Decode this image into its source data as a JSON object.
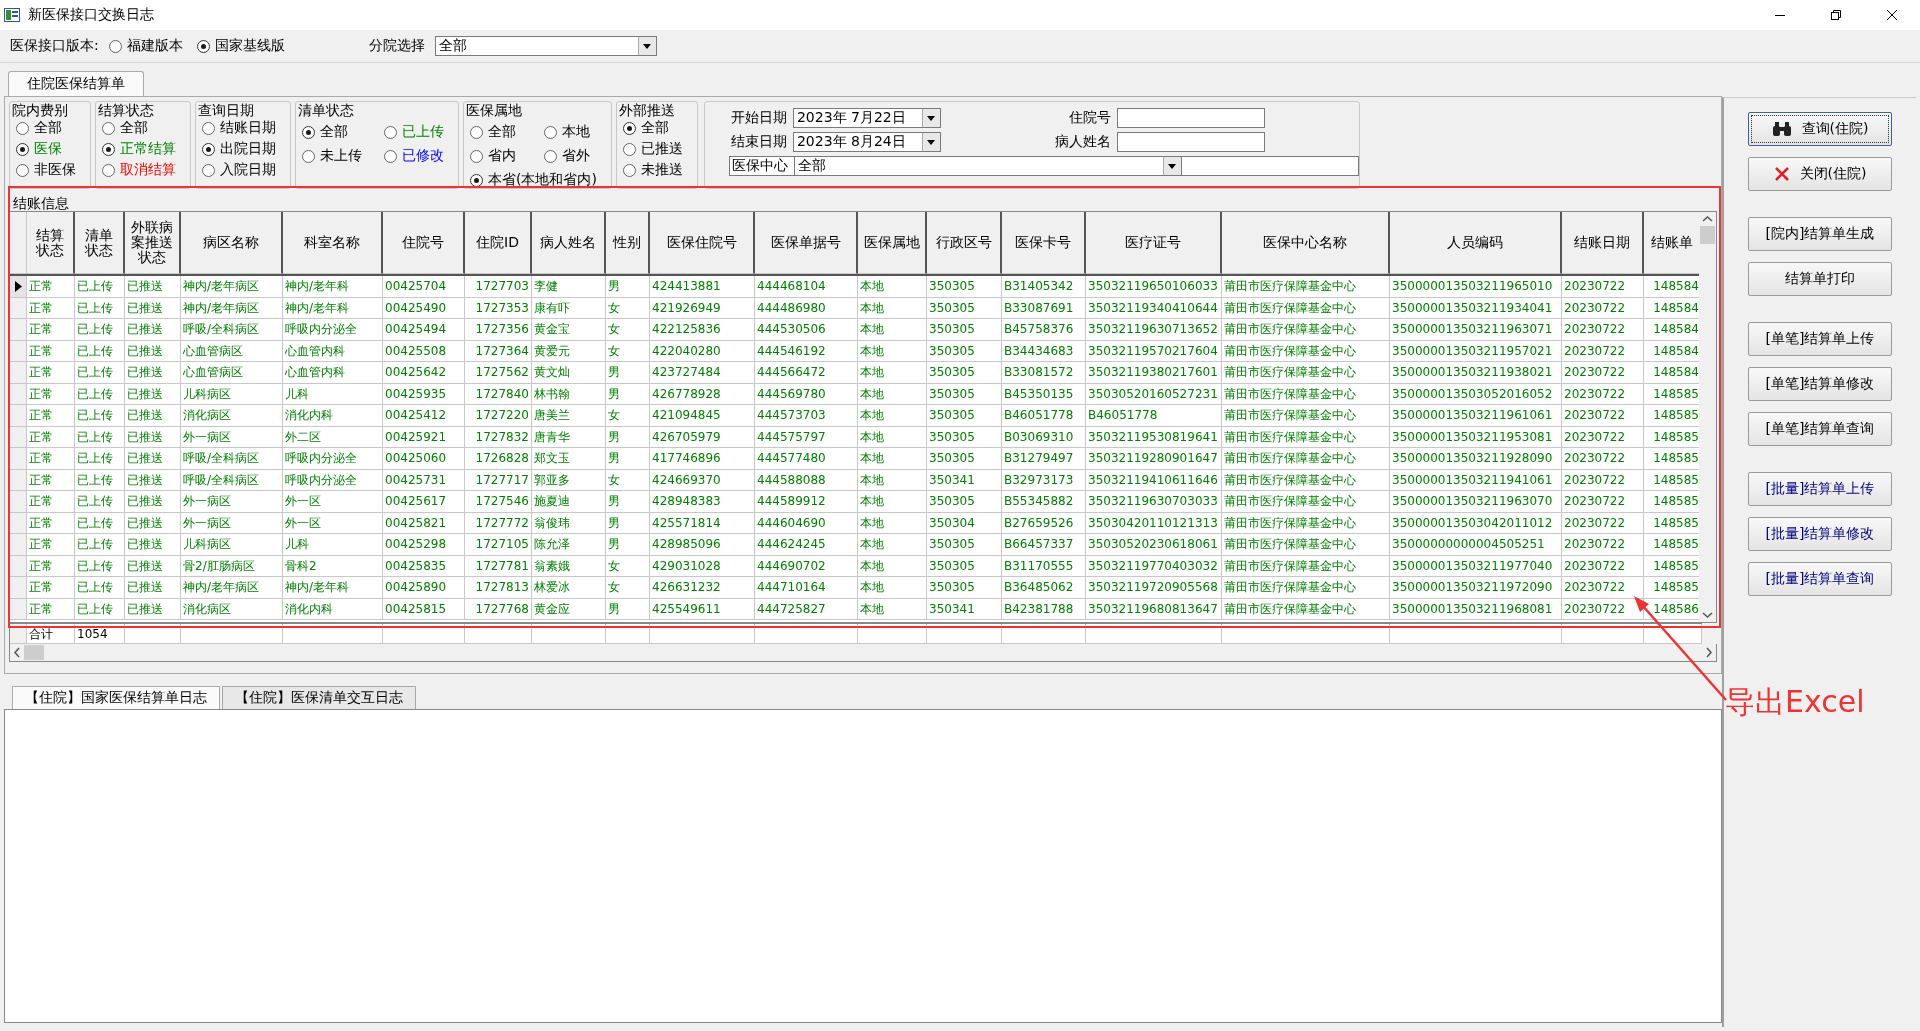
{
  "window": {
    "title": "新医保接口交换日志"
  },
  "version_bar": {
    "label": "医保接口版本:",
    "options": [
      {
        "label": "福建版本",
        "selected": false
      },
      {
        "label": "国家基线版",
        "selected": true
      }
    ],
    "branch_label": "分院选择",
    "branch_value": "全部"
  },
  "main_tab": {
    "label": "住院医保结算单",
    "selected": true
  },
  "filter_groups": [
    {
      "title": "院内费别",
      "kind": "stack",
      "options": [
        {
          "label": "全部",
          "selected": false
        },
        {
          "label": "医保",
          "selected": true,
          "color": "#008000"
        },
        {
          "label": "非医保",
          "selected": false
        }
      ]
    },
    {
      "title": "结算状态",
      "kind": "stack",
      "options": [
        {
          "label": "全部",
          "selected": false
        },
        {
          "label": "正常结算",
          "selected": true,
          "color": "#008000"
        },
        {
          "label": "取消结算",
          "selected": false,
          "color": "#ff0000"
        }
      ]
    },
    {
      "title": "查询日期",
      "kind": "stack",
      "options": [
        {
          "label": "结账日期",
          "selected": false
        },
        {
          "label": "出院日期",
          "selected": true
        },
        {
          "label": "入院日期",
          "selected": false
        }
      ]
    },
    {
      "title": "清单状态",
      "kind": "grid",
      "options": [
        {
          "label": "全部",
          "selected": true
        },
        {
          "label": "已上传",
          "selected": false,
          "color": "#008000"
        },
        {
          "label": "未上传",
          "selected": false
        },
        {
          "label": "已修改",
          "selected": false,
          "color": "#0000ff"
        }
      ]
    },
    {
      "title": "医保属地",
      "kind": "grid",
      "options": [
        {
          "label": "全部",
          "selected": false
        },
        {
          "label": "本地",
          "selected": false
        },
        {
          "label": "省内",
          "selected": false
        },
        {
          "label": "省外",
          "selected": false
        },
        {
          "label": "本省(本地和省内)",
          "selected": true
        }
      ]
    },
    {
      "title": "外部推送",
      "kind": "stack",
      "options": [
        {
          "label": "全部",
          "selected": true
        },
        {
          "label": "已推送",
          "selected": false
        },
        {
          "label": "未推送",
          "selected": false
        }
      ]
    }
  ],
  "search_fields": [
    {
      "label": "开始日期",
      "kind": "date",
      "value": "2023年 7月22日"
    },
    {
      "label": "住院号",
      "kind": "text"
    },
    {
      "label": "结束日期",
      "kind": "date",
      "value": "2023年 8月24日"
    },
    {
      "label": "病人姓名",
      "kind": "text"
    },
    {
      "label": "医保中心",
      "kind": "combo",
      "value": "全部"
    }
  ],
  "table": {
    "title": "结账信息",
    "columns": [
      "结算状态",
      "清单状态",
      "外联病案推送状态",
      "病区名称",
      "科室名称",
      "住院号",
      "住院ID",
      "病人姓名",
      "性别",
      "医保住院号",
      "医保单据号",
      "医保属地",
      "行政区号",
      "医保卡号",
      "医疗证号",
      "医保中心名称",
      "人员编码",
      "结账日期",
      "结账单"
    ],
    "rows": [
      {
        "selected": true,
        "cells": [
          "正常",
          "已上传",
          "已推送",
          "神内/老年病区",
          "神内/老年科",
          "00425704",
          "1727703",
          "李健",
          "男",
          "424413881",
          "444468104",
          "本地",
          "350305",
          "B31405342",
          "35032119650106033",
          "莆田市医疗保障基金中心",
          "350000013503211965010",
          "20230722",
          "148584"
        ]
      },
      {
        "selected": false,
        "cells": [
          "正常",
          "已上传",
          "已推送",
          "神内/老年病区",
          "神内/老年科",
          "00425490",
          "1727353",
          "康有吓",
          "女",
          "421926949",
          "444486980",
          "本地",
          "350305",
          "B33087691",
          "35032119340410644",
          "莆田市医疗保障基金中心",
          "350000013503211934041",
          "20230722",
          "148584"
        ]
      },
      {
        "selected": false,
        "cells": [
          "正常",
          "已上传",
          "已推送",
          "呼吸/全科病区",
          "呼吸内分泌全",
          "00425494",
          "1727356",
          "黄金宝",
          "女",
          "422125836",
          "444530506",
          "本地",
          "350305",
          "B45758376",
          "35032119630713652",
          "莆田市医疗保障基金中心",
          "350000013503211963071",
          "20230722",
          "148584"
        ]
      },
      {
        "selected": false,
        "cells": [
          "正常",
          "已上传",
          "已推送",
          "心血管病区",
          "心血管内科",
          "00425508",
          "1727364",
          "黄爱元",
          "女",
          "422040280",
          "444546192",
          "本地",
          "350305",
          "B34434683",
          "35032119570217604",
          "莆田市医疗保障基金中心",
          "350000013503211957021",
          "20230722",
          "148584"
        ]
      },
      {
        "selected": false,
        "cells": [
          "正常",
          "已上传",
          "已推送",
          "心血管病区",
          "心血管内科",
          "00425642",
          "1727562",
          "黄文灿",
          "男",
          "423727484",
          "444566472",
          "本地",
          "350305",
          "B33081572",
          "35032119380217601",
          "莆田市医疗保障基金中心",
          "350000013503211938021",
          "20230722",
          "148584"
        ]
      },
      {
        "selected": false,
        "cells": [
          "正常",
          "已上传",
          "已推送",
          "儿科病区",
          "儿科",
          "00425935",
          "1727840",
          "林书翰",
          "男",
          "426778928",
          "444569780",
          "本地",
          "350305",
          "B45350135",
          "35030520160527231",
          "莆田市医疗保障基金中心",
          "350000013503052016052",
          "20230722",
          "148585"
        ]
      },
      {
        "selected": false,
        "cells": [
          "正常",
          "已上传",
          "已推送",
          "消化病区",
          "消化内科",
          "00425412",
          "1727220",
          "唐美兰",
          "女",
          "421094845",
          "444573703",
          "本地",
          "350305",
          "B46051778",
          "B46051778",
          "莆田市医疗保障基金中心",
          "350000013503211961061",
          "20230722",
          "148585"
        ]
      },
      {
        "selected": false,
        "cells": [
          "正常",
          "已上传",
          "已推送",
          "外一病区",
          "外二区",
          "00425921",
          "1727832",
          "唐青华",
          "男",
          "426705979",
          "444575797",
          "本地",
          "350305",
          "B03069310",
          "35032119530819641",
          "莆田市医疗保障基金中心",
          "350000013503211953081",
          "20230722",
          "148585"
        ]
      },
      {
        "selected": false,
        "cells": [
          "正常",
          "已上传",
          "已推送",
          "呼吸/全科病区",
          "呼吸内分泌全",
          "00425060",
          "1726828",
          "郑文玉",
          "男",
          "417746896",
          "444577480",
          "本地",
          "350305",
          "B31279497",
          "35032119280901647",
          "莆田市医疗保障基金中心",
          "350000013503211928090",
          "20230722",
          "148585"
        ]
      },
      {
        "selected": false,
        "cells": [
          "正常",
          "已上传",
          "已推送",
          "呼吸/全科病区",
          "呼吸内分泌全",
          "00425731",
          "1727717",
          "郭亚多",
          "女",
          "424669370",
          "444588088",
          "本地",
          "350341",
          "B32973173",
          "35032119410611646",
          "莆田市医疗保障基金中心",
          "350000013503211941061",
          "20230722",
          "148585"
        ]
      },
      {
        "selected": false,
        "cells": [
          "正常",
          "已上传",
          "已推送",
          "外一病区",
          "外一区",
          "00425617",
          "1727546",
          "施夏迪",
          "男",
          "428948383",
          "444589912",
          "本地",
          "350305",
          "B55345882",
          "35032119630703033",
          "莆田市医疗保障基金中心",
          "350000013503211963070",
          "20230722",
          "148585"
        ]
      },
      {
        "selected": false,
        "cells": [
          "正常",
          "已上传",
          "已推送",
          "外一病区",
          "外一区",
          "00425821",
          "1727772",
          "翁俊玮",
          "男",
          "425571814",
          "444604690",
          "本地",
          "350304",
          "B27659526",
          "35030420110121313",
          "莆田市医疗保障基金中心",
          "350000013503042011012",
          "20230722",
          "148585"
        ]
      },
      {
        "selected": false,
        "cells": [
          "正常",
          "已上传",
          "已推送",
          "儿科病区",
          "儿科",
          "00425298",
          "1727105",
          "陈允泽",
          "男",
          "428985096",
          "444624245",
          "本地",
          "350305",
          "B66457337",
          "35030520230618061",
          "莆田市医疗保障基金中心",
          "35000000000004505251",
          "20230722",
          "148585"
        ]
      },
      {
        "selected": false,
        "cells": [
          "正常",
          "已上传",
          "已推送",
          "骨2/肛肠病区",
          "骨科2",
          "00425835",
          "1727781",
          "翁素娥",
          "女",
          "429031028",
          "444690702",
          "本地",
          "350305",
          "B31170555",
          "35032119770403032",
          "莆田市医疗保障基金中心",
          "350000013503211977040",
          "20230722",
          "148585"
        ]
      },
      {
        "selected": false,
        "cells": [
          "正常",
          "已上传",
          "已推送",
          "神内/老年病区",
          "神内/老年科",
          "00425890",
          "1727813",
          "林爱冰",
          "女",
          "426631232",
          "444710164",
          "本地",
          "350305",
          "B36485062",
          "35032119720905568",
          "莆田市医疗保障基金中心",
          "350000013503211972090",
          "20230722",
          "148585"
        ]
      },
      {
        "selected": false,
        "cells": [
          "正常",
          "已上传",
          "已推送",
          "消化病区",
          "消化内科",
          "00425815",
          "1727768",
          "黄金应",
          "男",
          "425549611",
          "444725827",
          "本地",
          "350341",
          "B42381788",
          "35032119680813647",
          "莆田市医疗保障基金中心",
          "350000013503211968081",
          "20230722",
          "148586"
        ]
      }
    ],
    "summary": {
      "label": "合计",
      "value": "1054"
    }
  },
  "log_tabs": [
    {
      "label": "【住院】国家医保结算单日志",
      "selected": true
    },
    {
      "label": "【住院】医保清单交互日志",
      "selected": false
    }
  ],
  "button_groups": [
    [
      {
        "label": "查询(住院)",
        "kind": "search",
        "color": "#000000"
      },
      {
        "label": "关闭(住院)",
        "kind": "close",
        "color": "#000000"
      }
    ],
    [
      {
        "label": "[院内]结算单生成",
        "kind": "plain",
        "color": "#000000"
      },
      {
        "label": "结算单打印",
        "kind": "plain",
        "color": "#000000"
      }
    ],
    [
      {
        "label": "[单笔]结算单上传",
        "kind": "plain",
        "color": "#000000"
      },
      {
        "label": "[单笔]结算单修改",
        "kind": "plain",
        "color": "#000000"
      },
      {
        "label": "[单笔]结算单查询",
        "kind": "plain",
        "color": "#000000"
      }
    ],
    [
      {
        "label": "[批量]结算单上传",
        "kind": "plain",
        "color": "#000080"
      },
      {
        "label": "[批量]结算单修改",
        "kind": "plain",
        "color": "#000080"
      },
      {
        "label": "[批量]结算单查询",
        "kind": "plain",
        "color": "#000080"
      }
    ]
  ],
  "annotation": {
    "text": "导出Excel"
  }
}
